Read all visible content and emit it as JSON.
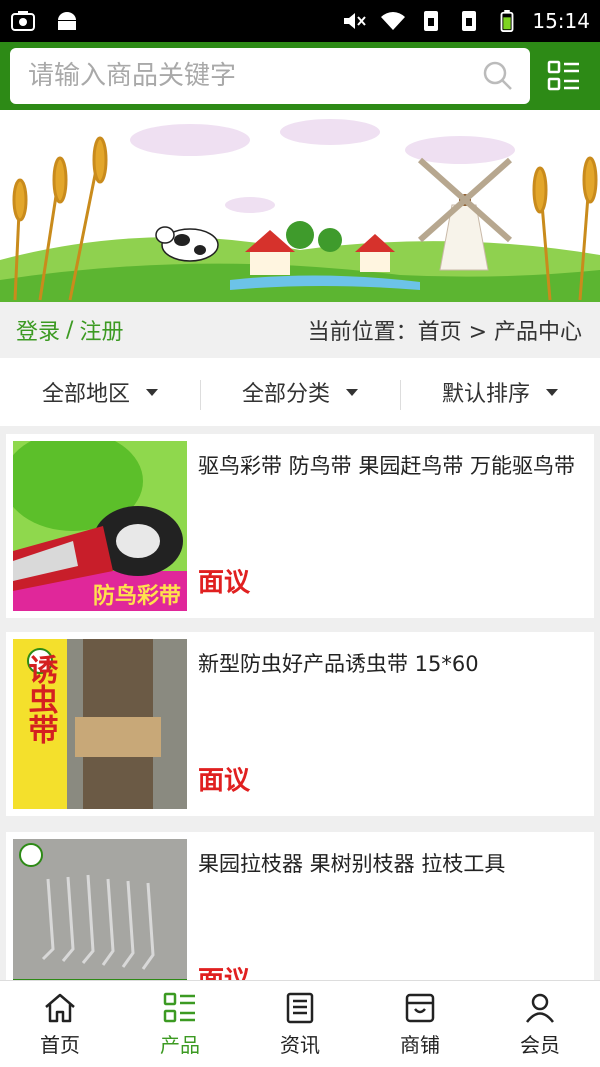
{
  "status_bar": {
    "time": "15:14"
  },
  "search": {
    "placeholder": "请输入商品关键字"
  },
  "location": {
    "login": "登录",
    "separator": "/",
    "register": "注册",
    "breadcrumb": "当前位置：首页 > 产品中心"
  },
  "filters": [
    {
      "label": "全部地区"
    },
    {
      "label": "全部分类"
    },
    {
      "label": "默认排序"
    }
  ],
  "products": [
    {
      "title": "驱鸟彩带 防鸟带 果园赶鸟带 万能驱鸟带",
      "price": "面议",
      "thumb_text": "防鸟彩带"
    },
    {
      "title": "新型防虫好产品诱虫带 15*60",
      "price": "面议",
      "thumb_text": "诱虫带"
    },
    {
      "title": "果园拉枝器 果树别枝器 拉枝工具",
      "price": "面议"
    }
  ],
  "nav": [
    {
      "label": "首页",
      "icon": "home-icon"
    },
    {
      "label": "产品",
      "icon": "list-icon",
      "active": true
    },
    {
      "label": "资讯",
      "icon": "news-icon"
    },
    {
      "label": "商铺",
      "icon": "store-icon"
    },
    {
      "label": "会员",
      "icon": "user-icon"
    }
  ],
  "colors": {
    "brand": "#2d8a16",
    "accent": "#3c9a22",
    "price": "#e02020"
  }
}
